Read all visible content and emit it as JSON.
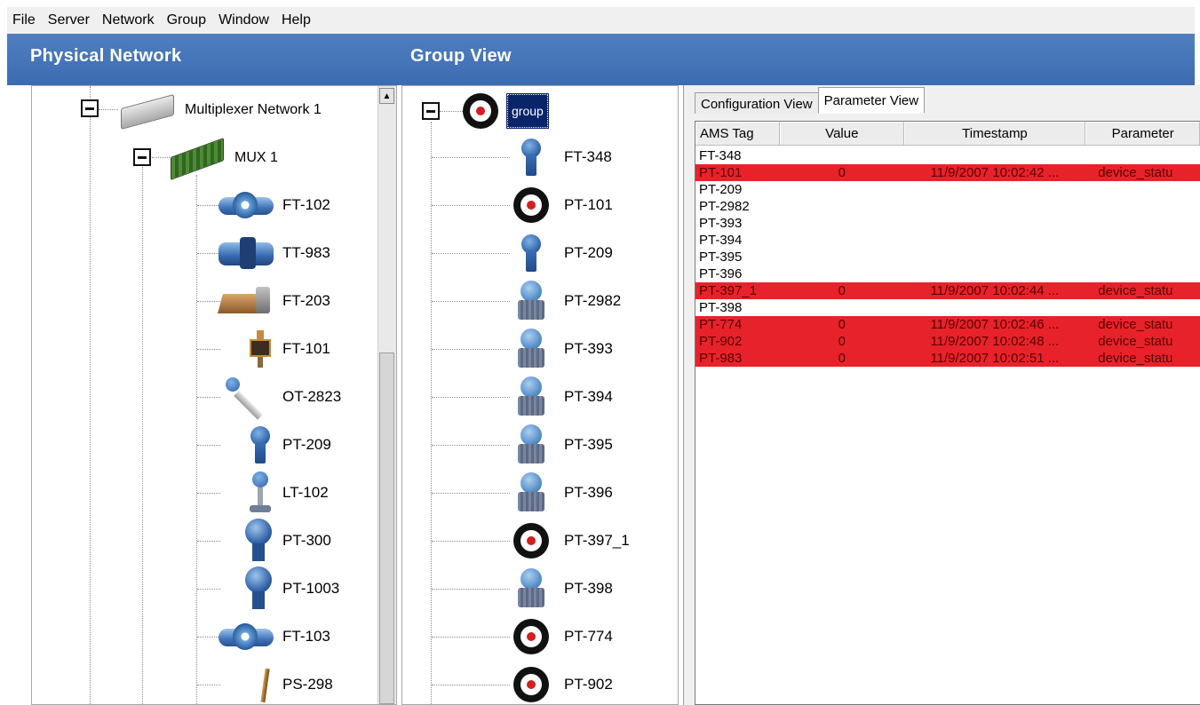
{
  "menu": [
    "File",
    "Server",
    "Network",
    "Group",
    "Window",
    "Help"
  ],
  "panels": {
    "physical_title": "Physical Network",
    "group_title": "Group View"
  },
  "physical_tree": {
    "network_label": "Multiplexer Network 1",
    "mux_label": "MUX 1",
    "devices": [
      {
        "label": "FT-102",
        "icon": "flow-meter-icon"
      },
      {
        "label": "TT-983",
        "icon": "temperature-transmitter-icon"
      },
      {
        "label": "FT-203",
        "icon": "flow-device-icon"
      },
      {
        "label": "FT-101",
        "icon": "gauge-icon"
      },
      {
        "label": "OT-2823",
        "icon": "probe-icon"
      },
      {
        "label": "PT-209",
        "icon": "pressure-transmitter-icon"
      },
      {
        "label": "LT-102",
        "icon": "level-transmitter-icon"
      },
      {
        "label": "PT-300",
        "icon": "pressure-transmitter-large-icon"
      },
      {
        "label": "PT-1003",
        "icon": "pressure-transmitter-large-icon"
      },
      {
        "label": "FT-103",
        "icon": "flow-meter-icon"
      },
      {
        "label": "PS-298",
        "icon": "pressure-switch-icon"
      }
    ]
  },
  "group_tree": {
    "root_label": "group",
    "items": [
      {
        "label": "FT-348",
        "icon": "pressure-transmitter-icon"
      },
      {
        "label": "PT-101",
        "icon": "alert-target-icon"
      },
      {
        "label": "PT-209",
        "icon": "pressure-transmitter-icon"
      },
      {
        "label": "PT-2982",
        "icon": "dp-transmitter-icon"
      },
      {
        "label": "PT-393",
        "icon": "dp-transmitter-icon"
      },
      {
        "label": "PT-394",
        "icon": "dp-transmitter-icon"
      },
      {
        "label": "PT-395",
        "icon": "dp-transmitter-icon"
      },
      {
        "label": "PT-396",
        "icon": "dp-transmitter-icon"
      },
      {
        "label": "PT-397_1",
        "icon": "alert-target-icon"
      },
      {
        "label": "PT-398",
        "icon": "dp-transmitter-icon"
      },
      {
        "label": "PT-774",
        "icon": "alert-target-icon"
      },
      {
        "label": "PT-902",
        "icon": "alert-target-icon"
      }
    ]
  },
  "tabs": [
    "Configuration View",
    "Parameter View"
  ],
  "active_tab": 1,
  "table": {
    "headers": [
      "AMS Tag",
      "Value",
      "Timestamp",
      "Parameter"
    ],
    "rows": [
      {
        "tag": "FT-348",
        "value": "",
        "timestamp": "",
        "parameter": "",
        "alert": false
      },
      {
        "tag": "PT-101",
        "value": "0",
        "timestamp": "11/9/2007 10:02:42 ...",
        "parameter": "device_statu",
        "alert": true
      },
      {
        "tag": "PT-209",
        "value": "",
        "timestamp": "",
        "parameter": "",
        "alert": false
      },
      {
        "tag": "PT-2982",
        "value": "",
        "timestamp": "",
        "parameter": "",
        "alert": false
      },
      {
        "tag": "PT-393",
        "value": "",
        "timestamp": "",
        "parameter": "",
        "alert": false
      },
      {
        "tag": "PT-394",
        "value": "",
        "timestamp": "",
        "parameter": "",
        "alert": false
      },
      {
        "tag": "PT-395",
        "value": "",
        "timestamp": "",
        "parameter": "",
        "alert": false
      },
      {
        "tag": "PT-396",
        "value": "",
        "timestamp": "",
        "parameter": "",
        "alert": false
      },
      {
        "tag": "PT-397_1",
        "value": "0",
        "timestamp": "11/9/2007 10:02:44 ...",
        "parameter": "device_statu",
        "alert": true
      },
      {
        "tag": "PT-398",
        "value": "",
        "timestamp": "",
        "parameter": "",
        "alert": false
      },
      {
        "tag": "PT-774",
        "value": "0",
        "timestamp": "11/9/2007 10:02:46 ...",
        "parameter": "device_statu",
        "alert": true
      },
      {
        "tag": "PT-902",
        "value": "0",
        "timestamp": "11/9/2007 10:02:48 ...",
        "parameter": "device_statu",
        "alert": true
      },
      {
        "tag": "PT-983",
        "value": "0",
        "timestamp": "11/9/2007 10:02:51 ...",
        "parameter": "device_statu",
        "alert": true
      }
    ]
  },
  "colors": {
    "header_blue": "#4575b8",
    "alert_red": "#e8222a",
    "selection_navy": "#0a246a"
  }
}
